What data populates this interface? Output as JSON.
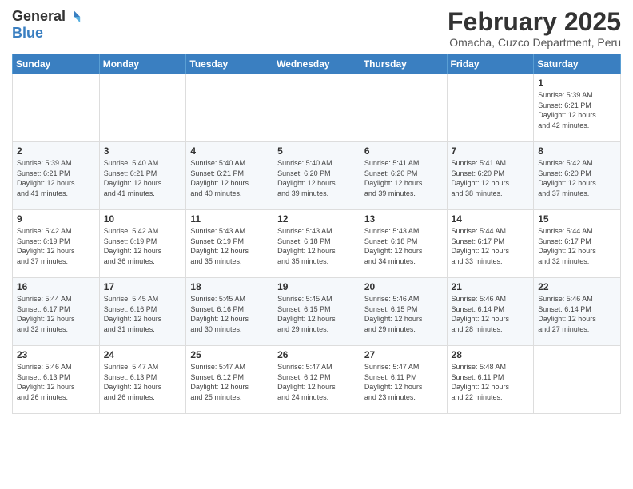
{
  "header": {
    "logo": {
      "general": "General",
      "blue": "Blue"
    },
    "title": "February 2025",
    "location": "Omacha, Cuzco Department, Peru"
  },
  "weekdays": [
    "Sunday",
    "Monday",
    "Tuesday",
    "Wednesday",
    "Thursday",
    "Friday",
    "Saturday"
  ],
  "weeks": [
    [
      {
        "day": "",
        "info": ""
      },
      {
        "day": "",
        "info": ""
      },
      {
        "day": "",
        "info": ""
      },
      {
        "day": "",
        "info": ""
      },
      {
        "day": "",
        "info": ""
      },
      {
        "day": "",
        "info": ""
      },
      {
        "day": "1",
        "info": "Sunrise: 5:39 AM\nSunset: 6:21 PM\nDaylight: 12 hours\nand 42 minutes."
      }
    ],
    [
      {
        "day": "2",
        "info": "Sunrise: 5:39 AM\nSunset: 6:21 PM\nDaylight: 12 hours\nand 41 minutes."
      },
      {
        "day": "3",
        "info": "Sunrise: 5:40 AM\nSunset: 6:21 PM\nDaylight: 12 hours\nand 41 minutes."
      },
      {
        "day": "4",
        "info": "Sunrise: 5:40 AM\nSunset: 6:21 PM\nDaylight: 12 hours\nand 40 minutes."
      },
      {
        "day": "5",
        "info": "Sunrise: 5:40 AM\nSunset: 6:20 PM\nDaylight: 12 hours\nand 39 minutes."
      },
      {
        "day": "6",
        "info": "Sunrise: 5:41 AM\nSunset: 6:20 PM\nDaylight: 12 hours\nand 39 minutes."
      },
      {
        "day": "7",
        "info": "Sunrise: 5:41 AM\nSunset: 6:20 PM\nDaylight: 12 hours\nand 38 minutes."
      },
      {
        "day": "8",
        "info": "Sunrise: 5:42 AM\nSunset: 6:20 PM\nDaylight: 12 hours\nand 37 minutes."
      }
    ],
    [
      {
        "day": "9",
        "info": "Sunrise: 5:42 AM\nSunset: 6:19 PM\nDaylight: 12 hours\nand 37 minutes."
      },
      {
        "day": "10",
        "info": "Sunrise: 5:42 AM\nSunset: 6:19 PM\nDaylight: 12 hours\nand 36 minutes."
      },
      {
        "day": "11",
        "info": "Sunrise: 5:43 AM\nSunset: 6:19 PM\nDaylight: 12 hours\nand 35 minutes."
      },
      {
        "day": "12",
        "info": "Sunrise: 5:43 AM\nSunset: 6:18 PM\nDaylight: 12 hours\nand 35 minutes."
      },
      {
        "day": "13",
        "info": "Sunrise: 5:43 AM\nSunset: 6:18 PM\nDaylight: 12 hours\nand 34 minutes."
      },
      {
        "day": "14",
        "info": "Sunrise: 5:44 AM\nSunset: 6:17 PM\nDaylight: 12 hours\nand 33 minutes."
      },
      {
        "day": "15",
        "info": "Sunrise: 5:44 AM\nSunset: 6:17 PM\nDaylight: 12 hours\nand 32 minutes."
      }
    ],
    [
      {
        "day": "16",
        "info": "Sunrise: 5:44 AM\nSunset: 6:17 PM\nDaylight: 12 hours\nand 32 minutes."
      },
      {
        "day": "17",
        "info": "Sunrise: 5:45 AM\nSunset: 6:16 PM\nDaylight: 12 hours\nand 31 minutes."
      },
      {
        "day": "18",
        "info": "Sunrise: 5:45 AM\nSunset: 6:16 PM\nDaylight: 12 hours\nand 30 minutes."
      },
      {
        "day": "19",
        "info": "Sunrise: 5:45 AM\nSunset: 6:15 PM\nDaylight: 12 hours\nand 29 minutes."
      },
      {
        "day": "20",
        "info": "Sunrise: 5:46 AM\nSunset: 6:15 PM\nDaylight: 12 hours\nand 29 minutes."
      },
      {
        "day": "21",
        "info": "Sunrise: 5:46 AM\nSunset: 6:14 PM\nDaylight: 12 hours\nand 28 minutes."
      },
      {
        "day": "22",
        "info": "Sunrise: 5:46 AM\nSunset: 6:14 PM\nDaylight: 12 hours\nand 27 minutes."
      }
    ],
    [
      {
        "day": "23",
        "info": "Sunrise: 5:46 AM\nSunset: 6:13 PM\nDaylight: 12 hours\nand 26 minutes."
      },
      {
        "day": "24",
        "info": "Sunrise: 5:47 AM\nSunset: 6:13 PM\nDaylight: 12 hours\nand 26 minutes."
      },
      {
        "day": "25",
        "info": "Sunrise: 5:47 AM\nSunset: 6:12 PM\nDaylight: 12 hours\nand 25 minutes."
      },
      {
        "day": "26",
        "info": "Sunrise: 5:47 AM\nSunset: 6:12 PM\nDaylight: 12 hours\nand 24 minutes."
      },
      {
        "day": "27",
        "info": "Sunrise: 5:47 AM\nSunset: 6:11 PM\nDaylight: 12 hours\nand 23 minutes."
      },
      {
        "day": "28",
        "info": "Sunrise: 5:48 AM\nSunset: 6:11 PM\nDaylight: 12 hours\nand 22 minutes."
      },
      {
        "day": "",
        "info": ""
      }
    ]
  ]
}
